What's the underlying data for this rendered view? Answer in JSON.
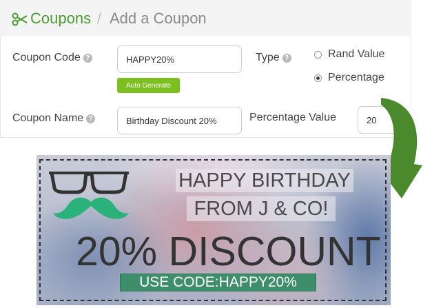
{
  "header": {
    "icon": "scissors-icon",
    "link_label": "Coupons",
    "separator": "/",
    "current_label": "Add a Coupon",
    "accent_color": "#4a9c2f"
  },
  "form": {
    "coupon_code": {
      "label": "Coupon Code",
      "value": "HAPPY20%"
    },
    "auto_generate_label": "Auto Generate",
    "type": {
      "label": "Type",
      "options": [
        {
          "label": "Rand Value",
          "selected": false
        },
        {
          "label": "Percentage",
          "selected": true
        }
      ]
    },
    "coupon_name": {
      "label": "Coupon Name",
      "value": "Birthday Discount 20%"
    },
    "percentage_value": {
      "label": "Percentage Value",
      "value": "20"
    },
    "help_icon": "question-circle-icon",
    "button_color": "#7cbf1e"
  },
  "banner": {
    "line1": "HAPPY BIRTHDAY",
    "line2": "FROM J & CO!",
    "headline": "20% DISCOUNT",
    "code_text": "USE CODE:HAPPY20%",
    "decor": [
      "glasses-icon",
      "mustache-icon"
    ],
    "mustache_color": "#2bb27a",
    "code_bg_color": "#3d8e6a"
  },
  "arrow": {
    "icon": "curved-arrow-icon",
    "color": "#4a8a2c"
  }
}
